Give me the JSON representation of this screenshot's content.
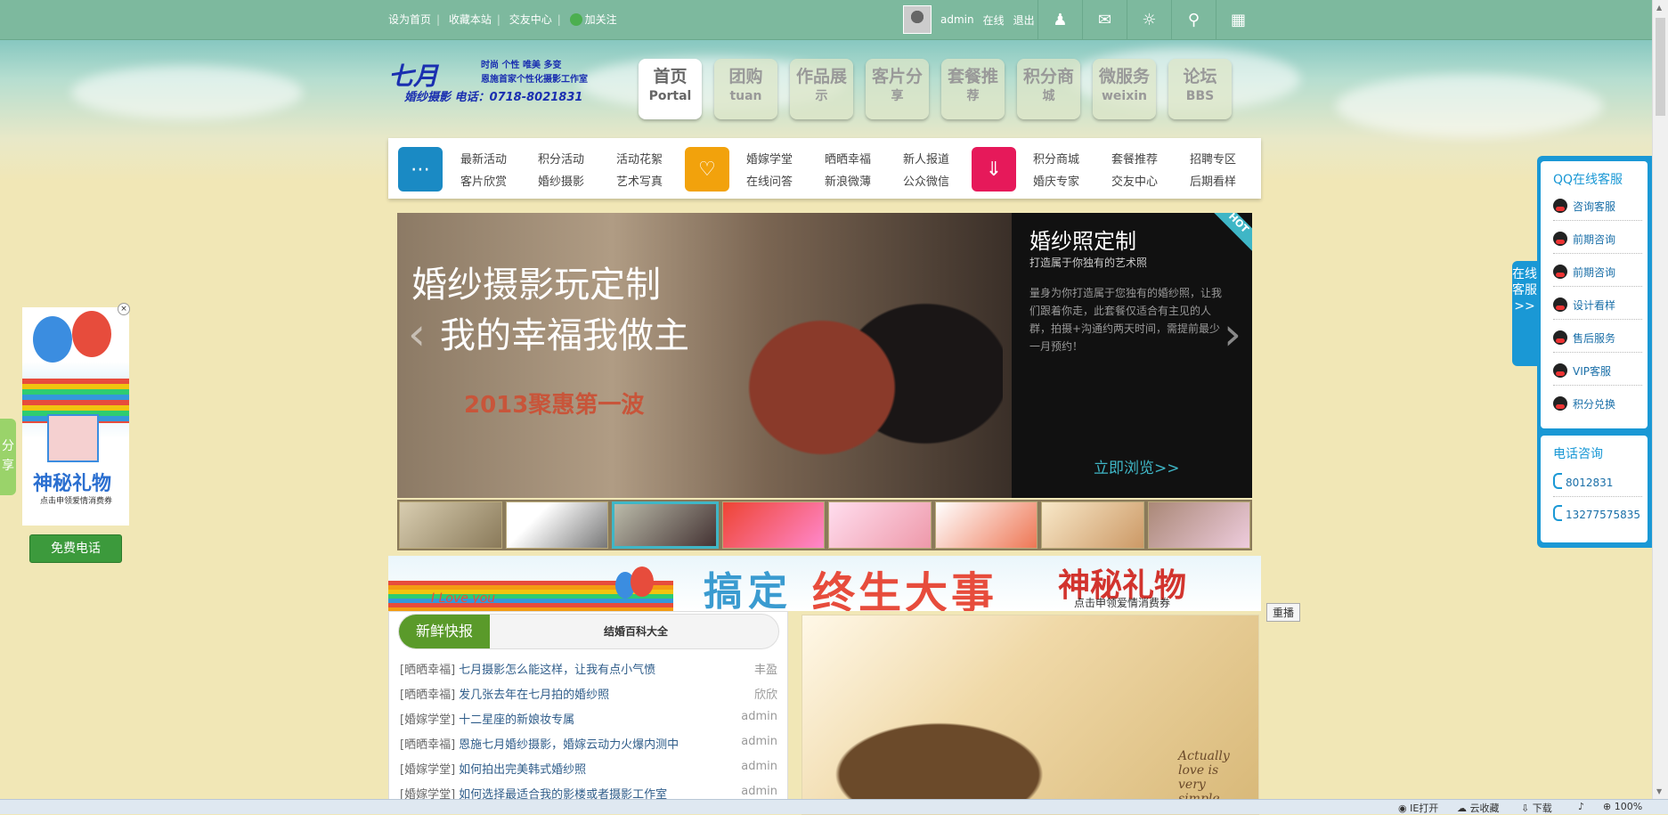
{
  "topbar": {
    "links": [
      "设为首页",
      "收藏本站",
      "交友中心"
    ],
    "follow": "加关注",
    "username": "admin",
    "online": "在线",
    "logout": "退出",
    "icons": [
      "user-icon",
      "mail-icon",
      "settings-icon",
      "search-icon",
      "grid-icon"
    ]
  },
  "logo": {
    "name": "七月",
    "tagline": "时尚 个性 唯美 多变",
    "sub": "恩施首家个性化摄影工作室",
    "bottom": "婚纱摄影  电话：0718-8021831"
  },
  "nav": [
    {
      "label": "首页",
      "sub": "Portal",
      "active": true
    },
    {
      "label": "团购",
      "sub": "tuan"
    },
    {
      "label": "作品展",
      "sub": "示"
    },
    {
      "label": "客片分",
      "sub": "享"
    },
    {
      "label": "套餐推",
      "sub": "荐"
    },
    {
      "label": "积分商",
      "sub": "城"
    },
    {
      "label": "微服务",
      "sub": "weixin"
    },
    {
      "label": "论坛",
      "sub": "BBS"
    }
  ],
  "subnav": {
    "group1": [
      "最新活动",
      "积分活动",
      "活动花絮",
      "客片欣赏",
      "婚纱摄影",
      "艺术写真"
    ],
    "group2": [
      "婚嫁学堂",
      "晒晒幸福",
      "新人报道",
      "在线问答",
      "新浪微薄",
      "公众微信"
    ],
    "group3": [
      "积分商城",
      "套餐推荐",
      "招聘专区",
      "婚庆专家",
      "交友中心",
      "后期看样"
    ],
    "colors": [
      "#1a8ac4",
      "#f2a20c",
      "#e6195a"
    ]
  },
  "banner": {
    "line1": "婚纱摄影玩定制",
    "line2": "我的幸福我做主",
    "line3": "2013聚惠第一波",
    "title": "婚纱照定制",
    "subtitle": "打造属于你独有的艺术照",
    "desc": "量身为你打造属于您独有的婚纱照，让我们跟着你走，此套餐仅适合有主见的人群，拍摄+沟通约两天时间，需提前最少一月预约！",
    "more": "立即浏览>>",
    "hot": "HOT"
  },
  "adstrip": {
    "loveyou": "I Love you",
    "t1": "搞定",
    "t2": "终生大事",
    "t3": "神秘礼物",
    "t4": "点击申领爱情消费券",
    "replay": "重播"
  },
  "news": {
    "tab_active": "新鲜快报",
    "tab_other": "结婚百科大全",
    "items": [
      {
        "cat": "[晒晒幸福]",
        "title": "七月摄影怎么能这样，让我有点小气愤",
        "author": "丰盈"
      },
      {
        "cat": "[晒晒幸福]",
        "title": "发几张去年在七月拍的婚纱照",
        "author": "欣欣"
      },
      {
        "cat": "[婚嫁学堂]",
        "title": "十二星座的新娘妆专属",
        "author": "admin"
      },
      {
        "cat": "[晒晒幸福]",
        "title": "恩施七月婚纱摄影，婚嫁云动力火爆内测中",
        "author": "admin"
      },
      {
        "cat": "[婚嫁学堂]",
        "title": "如何拍出完美韩式婚纱照",
        "author": "admin"
      },
      {
        "cat": "[婚嫁学堂]",
        "title": "如何选择最适合我的影楼或者摄影工作室",
        "author": "admin"
      }
    ]
  },
  "photo": {
    "sig": "Actually love is very simple"
  },
  "left": {
    "gift1": "神秘礼物",
    "gift2": "点击申领爱情消费券",
    "close": "×",
    "freecall": "免费电话",
    "share": "分享"
  },
  "kefu": {
    "tab": "在线客服>>",
    "qq_title": "QQ在线客服",
    "items": [
      "咨询客服",
      "前期咨询",
      "前期咨询",
      "设计看样",
      "售后服务",
      "VIP客服",
      "积分兑换"
    ],
    "phone_title": "电话咨询",
    "phones": [
      "8012831",
      "13277575835"
    ]
  },
  "status": {
    "ie": "IE打开",
    "cloud": "云收藏",
    "download": "下载",
    "zoom": "100%"
  }
}
